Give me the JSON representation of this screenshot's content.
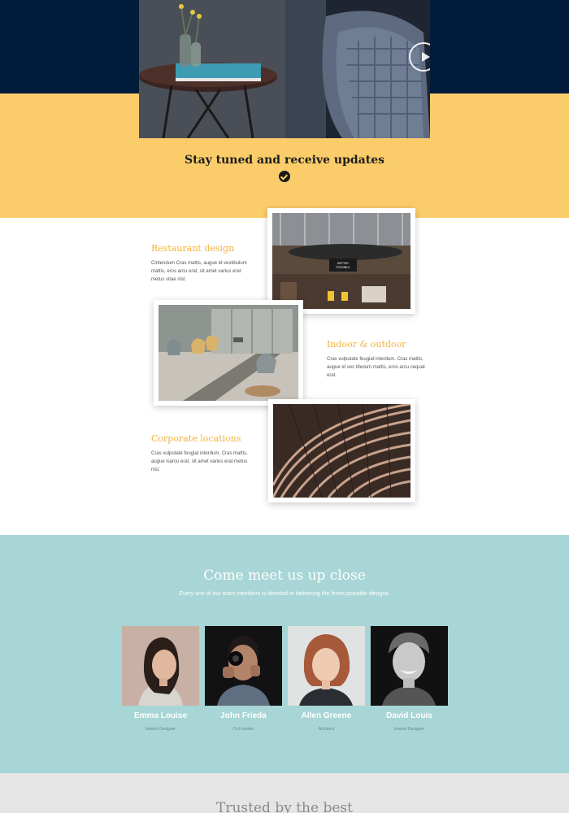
{
  "hero": {
    "title": "Stay tuned and receive updates",
    "video": {
      "action": "play"
    }
  },
  "features": [
    {
      "title": "Restaurant design",
      "text": "Cintendum Cras mattis, augue id vestibulum mattis, eros arcu erat, sit amet varius erat metus vitae nisl.",
      "photo_sign": "BETTER IS POSSIBLE"
    },
    {
      "title": "Indoor & outdoor",
      "text": "Cras vulputate feugiat interdum. Cras mattis, augue id ves tibulum mattis, eros arcu cequat erat."
    },
    {
      "title": "Corporate locations",
      "text": "Cras vulputate feugiat interdum. Cras mattis, augue isarcu erat. sit amet varius erat metus nisl."
    }
  ],
  "team": {
    "title": "Come meet us up close",
    "subtitle": "Every one of our team members is devoted to delivering the finest possible designs.",
    "members": [
      {
        "name": "Emma Louise",
        "role": "Interior Designer"
      },
      {
        "name": "John Frieda",
        "role": "Co Founder"
      },
      {
        "name": "Allen Greene",
        "role": "Architect"
      },
      {
        "name": "David Louis",
        "role": "Interior Designer"
      }
    ]
  },
  "trusted": {
    "title": "Trusted by the best"
  },
  "colors": {
    "navy": "#021c3b",
    "yellow": "#fbcd6a",
    "accent": "#f2b33c",
    "teal": "#a8d5d5",
    "grey": "#e5e5e5"
  }
}
